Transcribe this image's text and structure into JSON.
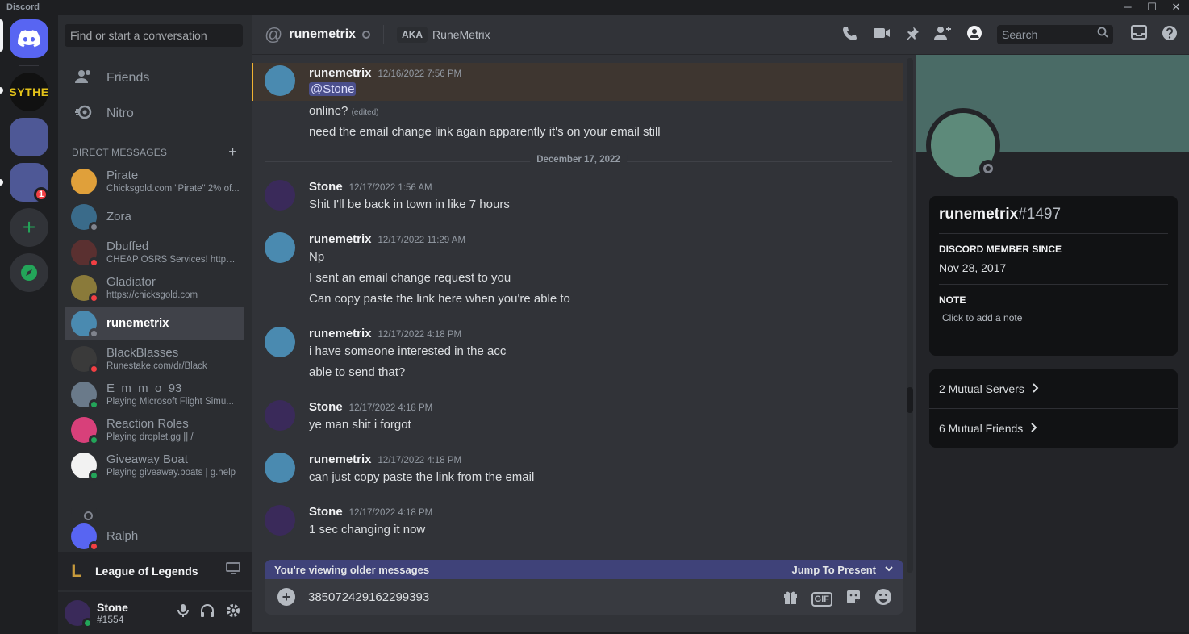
{
  "window": {
    "title": "Discord",
    "minimize": "─",
    "maximize": "☐",
    "close": "✕"
  },
  "guilds": {
    "home_icon": "discord-logo-icon",
    "sythe_label": "SYTHE",
    "badge_count": "1",
    "add_server": "+",
    "explore": "✦"
  },
  "dm_sidebar": {
    "search_placeholder": "Find or start a conversation",
    "nav": [
      {
        "label": "Friends",
        "icon": "friends-icon"
      },
      {
        "label": "Nitro",
        "icon": "nitro-icon"
      }
    ],
    "header": "Direct Messages",
    "add": "+",
    "dms": [
      {
        "name": "Pirate",
        "sub": "Chicksgold.com \"Pirate\" 2% of...",
        "status": "none",
        "color": "#e0a03a"
      },
      {
        "name": "Zora",
        "sub": "",
        "status": "offline",
        "color": "#3a6b8a"
      },
      {
        "name": "Dbuffed",
        "sub": "CHEAP OSRS Services! https:...",
        "status": "dnd",
        "color": "#5a3030"
      },
      {
        "name": "Gladiator",
        "sub": "https://chicksgold.com",
        "status": "dnd",
        "color": "#8a7a3a"
      },
      {
        "name": "runemetrix",
        "sub": "",
        "status": "offline",
        "color": "#4a8ab0"
      },
      {
        "name": "BlackBlasses",
        "sub": "Runestake.com/dr/Black",
        "status": "dnd",
        "color": "#3a3a3a"
      },
      {
        "name": "E_m_m_o_93",
        "sub": "Playing Microsoft Flight Simu...",
        "status": "online",
        "color": "#6a7a8a"
      },
      {
        "name": "Reaction Roles",
        "sub": "Playing droplet.gg || /",
        "status": "online",
        "color": "#d8407a"
      },
      {
        "name": "Giveaway Boat",
        "sub": "Playing giveaway.boats | g.help",
        "status": "online",
        "color": "#f2f2f2"
      },
      {
        "name": "",
        "sub": "",
        "status": "offline",
        "color": "#2b2d31"
      },
      {
        "name": "Ralph",
        "sub": "",
        "status": "dnd",
        "color": "#5865f2"
      }
    ],
    "game": {
      "name": "League of Legends",
      "logo": "L"
    },
    "user": {
      "name": "Stone",
      "tag": "#1554"
    }
  },
  "topbar": {
    "name": "runemetrix",
    "aka_label": "AKA",
    "aka_name": "RuneMetrix",
    "search_placeholder": "Search"
  },
  "messages": {
    "date_divider": "December 17, 2022",
    "groups": [
      {
        "author": "runemetrix",
        "time": "12/16/2022 7:56 PM",
        "lines": [
          "@Stone",
          "online?",
          "need the email change link again apparently it's on your email still"
        ],
        "edited": "(edited)"
      },
      {
        "author": "Stone",
        "time": "12/17/2022 1:56 AM",
        "lines": [
          "Shit I'll be back in town in like 7 hours"
        ]
      },
      {
        "author": "runemetrix",
        "time": "12/17/2022 11:29 AM",
        "lines": [
          "Np",
          "I sent an email change request to you",
          "Can copy paste the link here when you're able to"
        ]
      },
      {
        "author": "runemetrix",
        "time": "12/17/2022 4:18 PM",
        "lines": [
          "i have someone interested in the acc",
          "able to send that?"
        ]
      },
      {
        "author": "Stone",
        "time": "12/17/2022 4:18 PM",
        "lines": [
          "ye man shit  i forgot"
        ]
      },
      {
        "author": "runemetrix",
        "time": "12/17/2022 4:18 PM",
        "lines": [
          "can just copy paste the link from the email"
        ]
      },
      {
        "author": "Stone",
        "time": "12/17/2022 4:18 PM",
        "lines": [
          "1 sec changing it now"
        ]
      }
    ]
  },
  "older_bar": {
    "label": "You're viewing older messages",
    "jump": "Jump To Present"
  },
  "composer": {
    "value": "385072429162299393",
    "gif": "GIF"
  },
  "profile": {
    "username": "runemetrix",
    "discriminator": "#1497",
    "member_since_label": "Discord Member Since",
    "member_since": "Nov 28, 2017",
    "note_label": "Note",
    "note_placeholder": "Click to add a note",
    "mutual_servers": "2 Mutual Servers",
    "mutual_friends": "6 Mutual Friends"
  },
  "colors": {
    "accent": "#5865f2",
    "online": "#23a559",
    "dnd": "#f23f43",
    "offline": "#80848e",
    "mention_bg": "#4b4f8c"
  }
}
